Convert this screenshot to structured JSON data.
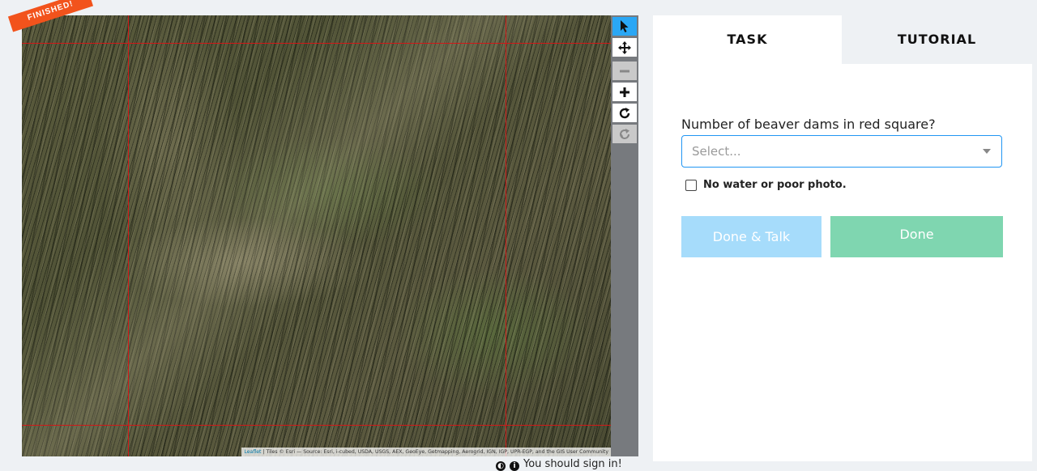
{
  "map": {
    "badge": "FINISHED!",
    "attribution_link": "Leaflet",
    "attribution_text": " | Tiles © Esri — Source: Esri, i-cubed, USDA, USGS, AEX, GeoEye, Getmapping, Aerogrid, IGN, IGP, UPR-EGP, and the GIS User Community"
  },
  "toolbar": {
    "items": [
      {
        "icon": "pointer-arrow-icon",
        "glyph": "➤",
        "state": "active"
      },
      {
        "icon": "move-icon",
        "glyph": "✥",
        "state": "normal"
      },
      {
        "icon": "zoom-out-icon",
        "glyph": "−",
        "state": "disabled"
      },
      {
        "icon": "zoom-in-icon",
        "glyph": "+",
        "state": "normal"
      },
      {
        "icon": "rotate-icon",
        "glyph": "↻",
        "state": "normal"
      },
      {
        "icon": "reset-icon",
        "glyph": "⟳",
        "state": "disabled"
      }
    ]
  },
  "footer": {
    "signin_text": "You should sign in!"
  },
  "panel": {
    "tabs": [
      "TASK",
      "TUTORIAL"
    ],
    "question": "Number of beaver dams in red square?",
    "select_placeholder": "Select...",
    "checkbox_label": "No water or poor photo.",
    "done_talk_label": "Done & Talk",
    "done_label": "Done"
  },
  "colors": {
    "accent": "#2aa7f5",
    "ribbon": "#f2531c",
    "done_talk": "#a6dcfb",
    "done": "#7fd6b0",
    "red_square": "#d01818"
  }
}
